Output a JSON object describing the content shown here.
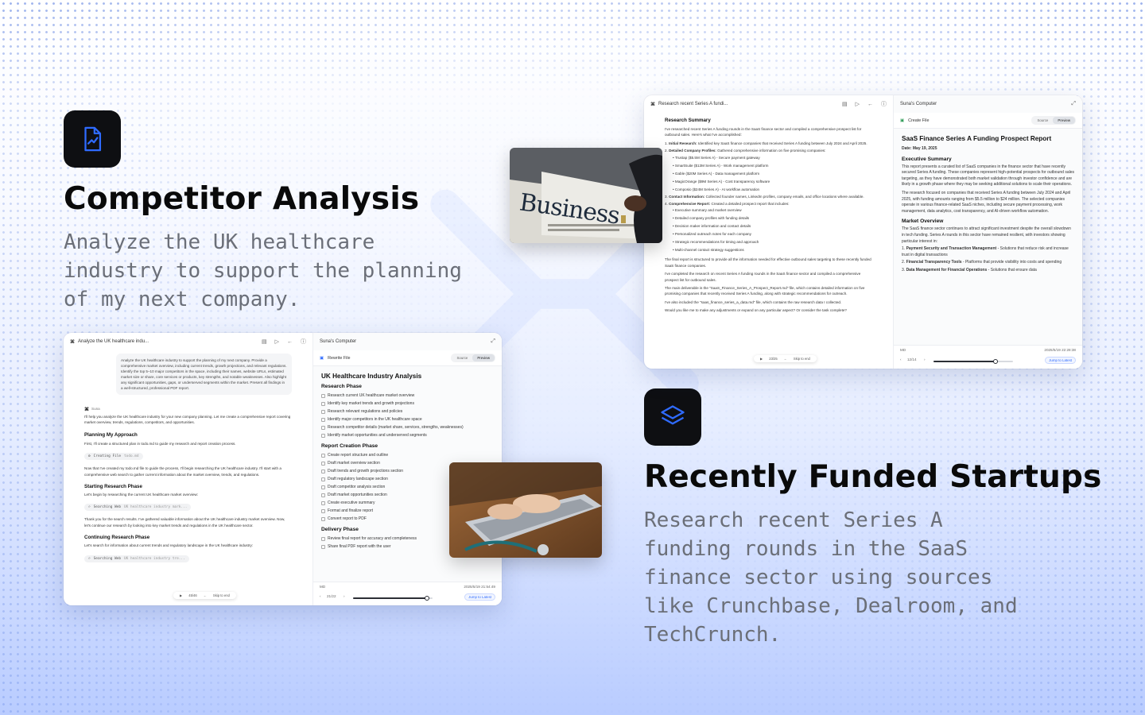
{
  "features": [
    {
      "title": "Competitor Analysis",
      "description": "Analyze the UK healthcare industry to support the planning of my next company."
    },
    {
      "title": "Recently Funded Startups",
      "description": "Research recent Series A funding rounds in the SaaS finance sector using sources like Crunchbase, Dealroom, and TechCrunch."
    }
  ],
  "colors": {
    "accent": "#2f6bff",
    "icon_bg": "#0e0f12",
    "title": "#0a0a0a",
    "desc": "#6b6f78"
  },
  "photos": {
    "business": "Business"
  },
  "window1": {
    "task_title": "Analyze the UK healthcare indu...",
    "computer_label": "Suna's Computer",
    "user_prompt": "Analyze the UK healthcare industry to support the planning of my next company. Provide a comprehensive market overview, including current trends, growth projections, and relevant regulations. Identify the top 5–10 major competitors in the space, including their names, website URLs, estimated market size or share, core services or products, key strengths, and notable weaknesses. Also highlight any significant opportunities, gaps, or underserved segments within the market. Present all findings in a well-structured, professional PDF report.",
    "agent_name": "Suna",
    "msg1": "I'll help you analyze the UK healthcare industry for your new company planning. Let me create a comprehensive report covering market overview, trends, regulations, competitors, and opportunities.",
    "h_planning": "Planning My Approach",
    "msg2": "First, I'll create a structured plan in todo.md to guide my research and report creation process.",
    "chip_create": "Creating File",
    "chip_create_arg": "todo.md",
    "msg3": "Now that I've created my todo.md file to guide the process, I'll begin researching the UK healthcare industry. I'll start with a comprehensive web search to gather current information about the market overview, trends, and regulations.",
    "h_starting": "Starting Research Phase",
    "msg4": "Let's begin by researching the current UK healthcare market overview:",
    "chip_search": "Searching Web",
    "chip_search_arg": "UK healthcare industry mark...",
    "msg5": "Thank you for the search results. I've gathered valuable information about the UK healthcare industry market overview. Now, let's continue our research by looking into key market trends and regulations in the UK healthcare sector.",
    "h_continuing": "Continuing Research Phase",
    "msg6": "Let's search for information about current trends and regulatory landscape in the UK healthcare industry:",
    "chip_search2": "Searching Web",
    "chip_search2_arg": "UK healthcare industry tre...",
    "play_count": "45/46",
    "skip_label": "Skip to end",
    "file_action": "Rewrite File",
    "source_label": "Source",
    "preview_label": "Preview",
    "doc_title": "UK Healthcare Industry Analysis",
    "phase1": "Research Phase",
    "phase1_items": [
      "Research current UK healthcare market overview",
      "Identify key market trends and growth projections",
      "Research relevant regulations and policies",
      "Identify major competitors in the UK healthcare space",
      "Research competitor details (market share, services, strengths, weaknesses)",
      "Identify market opportunities and underserved segments"
    ],
    "phase2": "Report Creation Phase",
    "phase2_items": [
      "Create report structure and outline",
      "Draft market overview section",
      "Draft trends and growth projections section",
      "Draft regulatory landscape section",
      "Draft competitor analysis section",
      "Draft market opportunities section",
      "Create executive summary",
      "Format and finalize report",
      "Convert report to PDF"
    ],
    "phase3": "Delivery Phase",
    "phase3_items": [
      "Review final report for accuracy and completeness",
      "Share final PDF report with the user"
    ],
    "file_type": "MD",
    "timestamp": "2025/5/19 21:54:49",
    "step": "21/22",
    "latest_label": "Jump to Latest",
    "progress": 0.93
  },
  "window2": {
    "task_title": "Research recent Series A fundi...",
    "computer_label": "Suna's Computer",
    "h_summary": "Research Summary",
    "intro": "I've researched recent Series A funding rounds in the SaaS finance sector and compiled a comprehensive prospect list for outbound sales. Here's what I've accomplished:",
    "steps": [
      {
        "label": "Initial Research:",
        "text": "Identified key SaaS finance companies that received Series A funding between July 2024 and April 2025."
      },
      {
        "label": "Detailed Company Profiles:",
        "text": "Gathered comprehensive information on five promising companies:"
      }
    ],
    "companies": [
      "Trustap ($5.5M Series A) - Secure payment gateway",
      "SmartSuite ($13M Series A) - Work management platform",
      "Gable ($20M Series A) - Data management platform",
      "MagicOrange ($9M Series A) - Cost transparency software",
      "Composio ($24M Series A) - AI workflow automation"
    ],
    "step3_label": "Contact Information:",
    "step3_text": "Collected founder names, LinkedIn profiles, company emails, and office locations where available.",
    "step4_label": "Comprehensive Report:",
    "step4_text": "Created a detailed prospect report that includes:",
    "report_items": [
      "Executive summary and market overview",
      "Detailed company profiles with funding details",
      "Decision maker information and contact details",
      "Personalized outreach notes for each company",
      "Strategic recommendations for timing and approach",
      "Multi-channel contact strategy suggestions"
    ],
    "para1": "The final report is structured to provide all the information needed for effective outbound sales targeting to these recently funded SaaS finance companies.",
    "para2": "I've completed the research on recent Series A funding rounds in the SaaS finance sector and compiled a comprehensive prospect list for outbound sales.",
    "para3": "The main deliverable is the \"SaaS_Finance_Series_A_Prospect_Report.md\" file, which contains detailed information on five promising companies that recently received Series A funding, along with strategic recommendations for outreach.",
    "para4": "I've also included the \"saas_finance_series_a_data.md\" file, which contains the raw research data I collected.",
    "para5": "Would you like me to make any adjustments or expand on any particular aspect? Or consider the task complete?",
    "play_count": "23/25",
    "skip_label": "Skip to end",
    "file_action": "Create File",
    "source_label": "Source",
    "preview_label": "Preview",
    "doc_title": "SaaS Finance Series A Funding Prospect Report",
    "date": "Date: May 19, 2025",
    "h_exec": "Executive Summary",
    "exec1": "This report presents a curated list of SaaS companies in the finance sector that have recently secured Series A funding. These companies represent high-potential prospects for outbound sales targeting, as they have demonstrated both market validation through investor confidence and are likely in a growth phase where they may be seeking additional solutions to scale their operations.",
    "exec2": "The research focused on companies that received Series A funding between July 2024 and April 2025, with funding amounts ranging from $5.5 million to $24 million. The selected companies operate in various finance-related SaaS niches, including secure payment processing, work management, data analytics, cost transparency, and AI-driven workflow automation.",
    "h_market": "Market Overview",
    "market": "The SaaS finance sector continues to attract significant investment despite the overall slowdown in tech funding. Series A rounds in this sector have remained resilient, with investors showing particular interest in:",
    "market_items": [
      {
        "label": "Payment Security and Transaction Management",
        "text": "- Solutions that reduce risk and increase trust in digital transactions"
      },
      {
        "label": "Financial Transparency Tools",
        "text": "- Platforms that provide visibility into costs and spending"
      },
      {
        "label": "Data Management for Financial Operations",
        "text": "- Solutions that ensure data"
      }
    ],
    "file_type": "MD",
    "timestamp": "2025/5/19 22:28:38",
    "step": "12/14",
    "latest_label": "Jump to Latest",
    "progress": 0.78
  }
}
